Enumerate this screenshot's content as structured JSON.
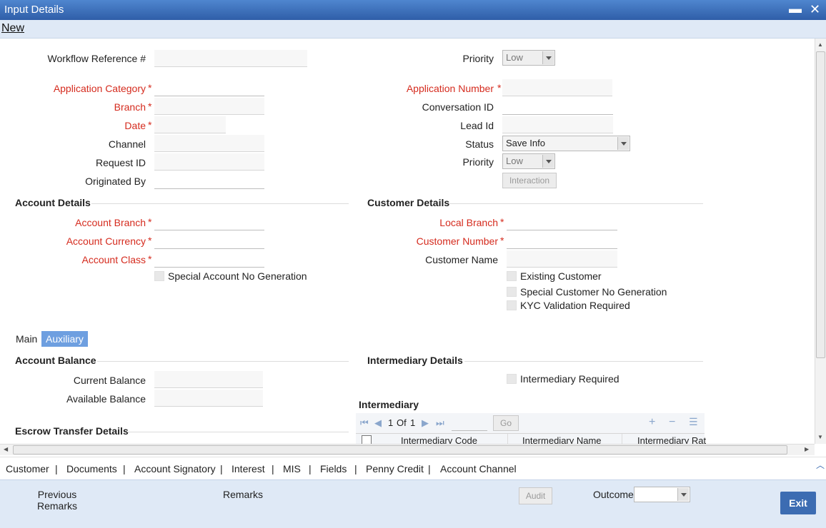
{
  "window": {
    "title": "Input Details",
    "minimize": "▬",
    "close": "✕"
  },
  "menu": {
    "new": "New"
  },
  "form": {
    "workflow_ref_label": "Workflow Reference #",
    "priority_label": "Priority",
    "priority_value": "Low",
    "application_category_label": "Application Category",
    "application_number_label": "Application Number",
    "branch_label": "Branch",
    "conversation_id_label": "Conversation ID",
    "date_label": "Date",
    "lead_id_label": "Lead Id",
    "channel_label": "Channel",
    "status_label": "Status",
    "status_value": "Save Info",
    "request_id_label": "Request ID",
    "priority2_label": "Priority",
    "priority2_value": "Low",
    "originated_by_label": "Originated By",
    "interaction_button": "Interaction",
    "required_mark": "*"
  },
  "account_details": {
    "heading": "Account Details",
    "account_branch_label": "Account Branch",
    "account_currency_label": "Account Currency",
    "account_class_label": "Account Class",
    "special_account_no_label": "Special Account No Generation"
  },
  "customer_details": {
    "heading": "Customer Details",
    "local_branch_label": "Local Branch",
    "customer_number_label": "Customer Number",
    "customer_name_label": "Customer Name",
    "existing_customer_label": "Existing Customer",
    "special_customer_no_label": "Special Customer No Generation",
    "kyc_label": "KYC Validation Required"
  },
  "tabs": {
    "main": "Main",
    "auxiliary": "Auxiliary"
  },
  "account_balance": {
    "heading": "Account Balance",
    "current_balance_label": "Current Balance",
    "available_balance_label": "Available Balance"
  },
  "intermediary_details": {
    "heading": "Intermediary Details",
    "required_label": "Intermediary Required",
    "grid_heading": "Intermediary",
    "page_current": "1",
    "page_of": "Of",
    "page_total": "1",
    "go_button": "Go",
    "columns": [
      "Intermediary Code",
      "Intermediary Name",
      "Intermediary Rat"
    ]
  },
  "escrow": {
    "heading": "Escrow Transfer Details"
  },
  "bottom_links": [
    "Customer",
    "Documents",
    "Account Signatory",
    "Interest",
    "MIS",
    "Fields",
    "Penny Credit",
    "Account Channel"
  ],
  "footer": {
    "previous_remarks_line1": "Previous",
    "previous_remarks_line2": "Remarks",
    "remarks_label": "Remarks",
    "audit_button": "Audit",
    "outcome_label": "Outcome",
    "exit_button": "Exit"
  },
  "colors": {
    "required": "#d52b1e",
    "titlebar": "#2f5ea8",
    "footer": "#dfe9f6",
    "accent_tab": "#6e9fe0",
    "exit": "#3c6cb2"
  }
}
